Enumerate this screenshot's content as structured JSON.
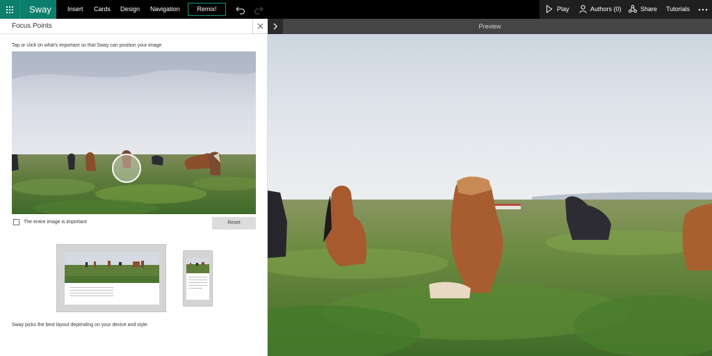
{
  "app": {
    "brand": "Sway"
  },
  "menu": {
    "insert": "Insert",
    "cards": "Cards",
    "design": "Design",
    "navigation": "Navigation",
    "remix": "Remix!"
  },
  "tools": {
    "play": "Play",
    "authors": "Authors (0)",
    "share": "Share",
    "tutorials": "Tutorials"
  },
  "panel": {
    "title": "Focus Points",
    "instruction": "Tap or click on what's important so that Sway can position your image",
    "checkbox_label": "The entire image is important",
    "checkbox_checked": false,
    "reset_label": "Reset",
    "footnote": "Sway picks the best layout depending on your device and style."
  },
  "preview": {
    "title": "Preview"
  },
  "icons": {
    "apps": "waffle-icon",
    "undo": "undo-icon",
    "redo": "redo-icon",
    "play": "play-icon",
    "authors": "person-icon",
    "share": "share-icon",
    "more": "more-icon",
    "close": "close-icon",
    "expand": "chevron-right-icon",
    "focus": "focus-point-icon"
  },
  "colors": {
    "brand": "#0b7f6b",
    "topbar": "#000000",
    "preview_header": "#454545"
  }
}
